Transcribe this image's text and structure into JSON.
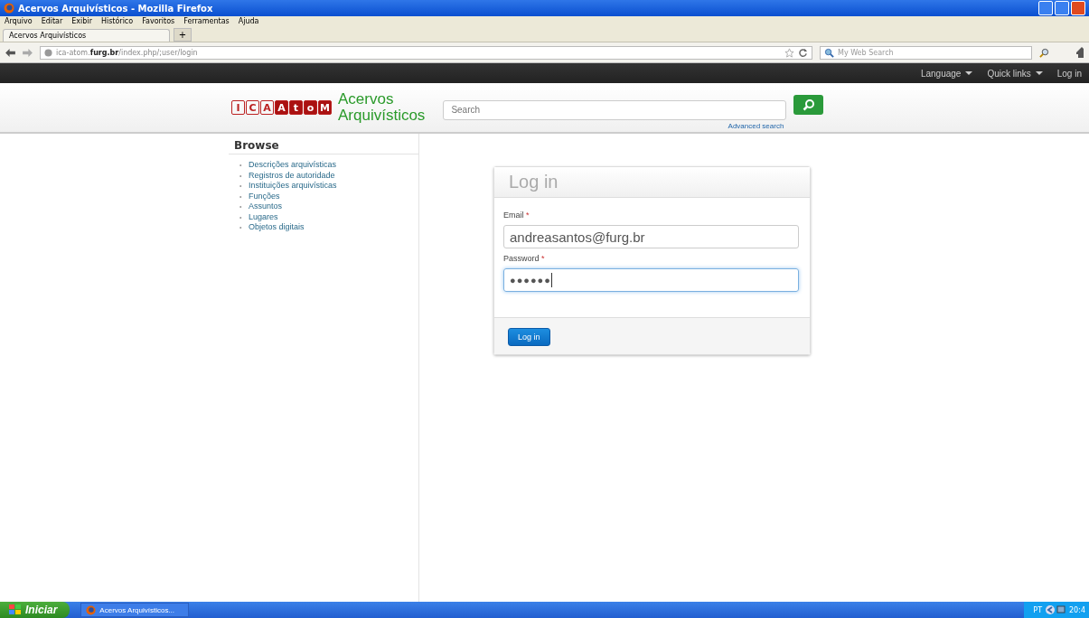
{
  "window": {
    "title": "Acervos Arquivísticos - Mozilla Firefox"
  },
  "menu": [
    "Arquivo",
    "Editar",
    "Exibir",
    "Histórico",
    "Favoritos",
    "Ferramentas",
    "Ajuda"
  ],
  "tabs": [
    {
      "label": "Acervos Arquivísticos",
      "selected": true
    }
  ],
  "new_tab": "+",
  "address": {
    "prefix": "ica-atom.",
    "domain": "furg.br",
    "path": "/index.php/;user/login"
  },
  "web_search": {
    "placeholder": "My Web Search"
  },
  "topbar": {
    "items": [
      {
        "label": "Language",
        "dropdown": true
      },
      {
        "label": "Quick links",
        "dropdown": true
      },
      {
        "label": "Log in",
        "dropdown": false
      }
    ]
  },
  "logo": {
    "letters": [
      {
        "char": "I",
        "filled": false
      },
      {
        "char": "C",
        "filled": false
      },
      {
        "char": "A",
        "filled": false
      },
      {
        "char": "A",
        "filled": true
      },
      {
        "char": "t",
        "filled": true
      },
      {
        "char": "o",
        "filled": true
      },
      {
        "char": "M",
        "filled": true
      }
    ],
    "site_name_lines": [
      "Acervos",
      "Arquivísticos"
    ]
  },
  "search": {
    "placeholder": "Search",
    "advanced": "Advanced search"
  },
  "browse": {
    "title": "Browse",
    "bullet": "•",
    "items": [
      "Descrições arquivísticas",
      "Registros de autoridade",
      "Instituições arquivísticas",
      "Funções",
      "Assuntos",
      "Lugares",
      "Objetos digitais"
    ]
  },
  "login": {
    "title": "Log in",
    "fields": [
      {
        "label": "Email",
        "required": "*",
        "value": "andreasantos@furg.br",
        "focused": false
      },
      {
        "label": "Password",
        "required": "*",
        "value": "●●●●●●",
        "focused": true
      }
    ],
    "button": "Log in"
  },
  "taskbar": {
    "start": "Iniciar",
    "tasks": [
      "Acervos Arquivísticos..."
    ],
    "lang": "PT",
    "clock": "20:4"
  }
}
